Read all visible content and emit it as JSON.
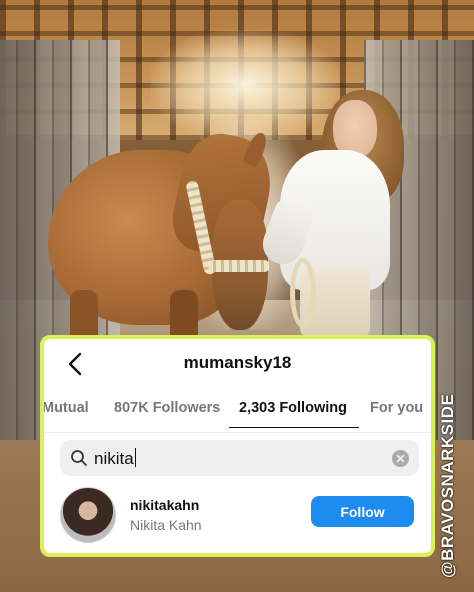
{
  "watermark": "@BRAVOSNARKSIDE",
  "profile": {
    "username": "mumansky18"
  },
  "tabs": [
    {
      "label": "Mutual",
      "active": false
    },
    {
      "label": "807K Followers",
      "active": false
    },
    {
      "label": "2,303 Following",
      "active": true
    },
    {
      "label": "For you",
      "active": false
    }
  ],
  "search": {
    "value": "nikita",
    "icon": "magnifier"
  },
  "result": {
    "username": "nikitakahn",
    "full_name": "Nikita Kahn",
    "follow_label": "Follow"
  },
  "colors": {
    "card_border": "#d9f25a",
    "follow_button": "#1c8cf1"
  }
}
